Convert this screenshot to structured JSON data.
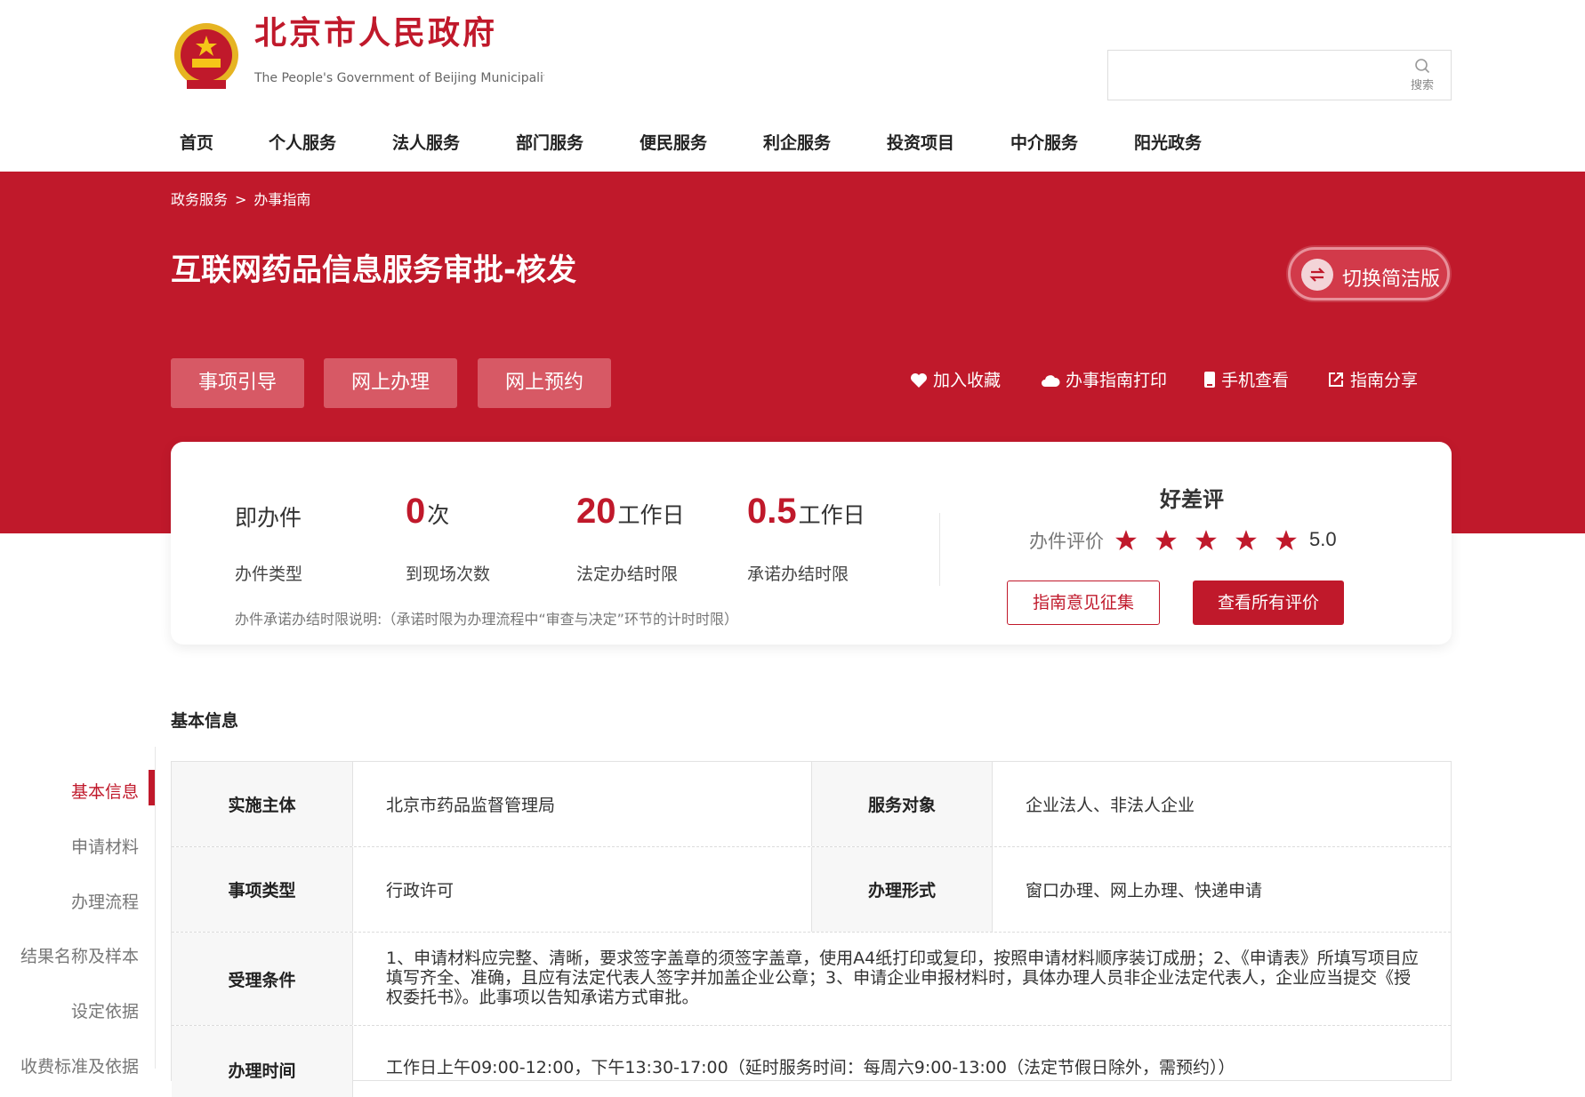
{
  "header": {
    "logo_cn": "北京市人民政府",
    "logo_en": "The People's Government of Beijing Municipality",
    "search": {
      "placeholder": "",
      "button_label": "搜索"
    },
    "nav": [
      "首页",
      "个人服务",
      "法人服务",
      "部门服务",
      "便民服务",
      "利企服务",
      "投资项目",
      "中介服务",
      "阳光政务"
    ]
  },
  "banner": {
    "breadcrumb": [
      "政务服务",
      "办事指南"
    ],
    "breadcrumb_sep": ">",
    "title": "互联网药品信息服务审批-核发",
    "switch_label": "切换简洁版",
    "tabs": [
      "事项引导",
      "网上办理",
      "网上预约"
    ],
    "actions": [
      {
        "label": "加入收藏",
        "icon": "heart-icon"
      },
      {
        "label": "办事指南打印",
        "icon": "cloud-icon"
      },
      {
        "label": "手机查看",
        "icon": "phone-icon"
      },
      {
        "label": "指南分享",
        "icon": "share-icon"
      }
    ]
  },
  "summary": {
    "type_value": "即办件",
    "type_label": "办件类型",
    "visits_value": "0",
    "visits_unit": "次",
    "visits_label": "到现场次数",
    "legal_value": "20",
    "legal_unit": "工作日",
    "legal_label": "法定办结时限",
    "promise_value": "0.5",
    "promise_unit": "工作日",
    "promise_label": "承诺办结时限",
    "note": "办件承诺办结时限说明:（承诺时限为办理流程中“审查与决定”环节的计时时限）",
    "rating_title": "好差评",
    "rating_label": "办件评价",
    "rating_stars": 5,
    "rating_score": "5.0",
    "feedback_button": "指南意见征集",
    "all_reviews_button": "查看所有评价"
  },
  "section_title": "基本信息",
  "sidebar": [
    "基本信息",
    "申请材料",
    "办理流程",
    "结果名称及样本",
    "设定依据",
    "收费标准及依据"
  ],
  "table": {
    "rows": [
      {
        "label": "实施主体",
        "value": "北京市药品监督管理局",
        "label2": "服务对象",
        "value2": "企业法人、非法人企业"
      },
      {
        "label": "事项类型",
        "value": "行政许可",
        "label2": "办理形式",
        "value2": "窗口办理、网上办理、快递申请"
      },
      {
        "label": "受理条件",
        "value": "1、申请材料应完整、清晰，要求签字盖章的须签字盖章，使用A4纸打印或复印，按照申请材料顺序装订成册；2、《申请表》所填写项目应填写齐全、准确，且应有法定代表人签字并加盖企业公章；3、申请企业申报材料时，具体办理人员非企业法定代表人，企业应当提交《授权委托书》。此事项以告知承诺方式审批。"
      },
      {
        "label": "办理时间",
        "value": "工作日上午09:00-12:00，下午13:30-17:00（延时服务时间：每周六9:00-13:00（法定节假日除外，需预约））"
      }
    ]
  },
  "colors": {
    "brand_red": "#c0192b"
  }
}
